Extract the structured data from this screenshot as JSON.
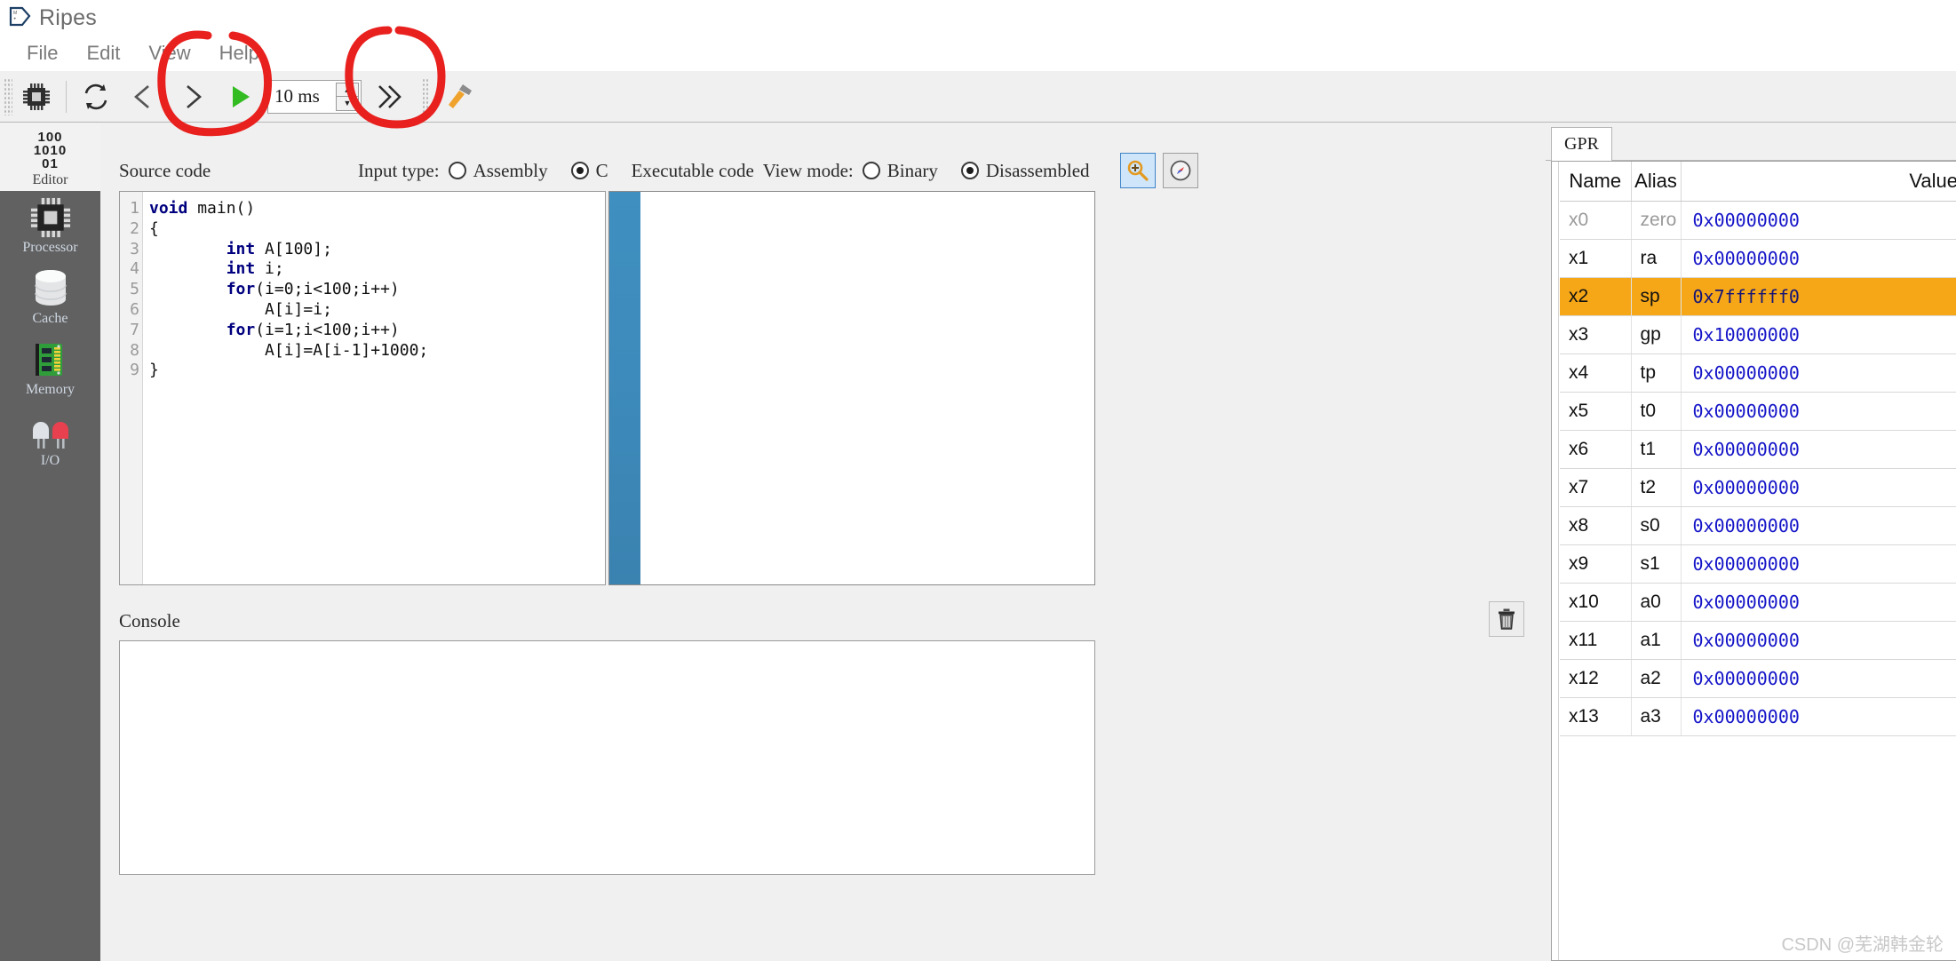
{
  "window": {
    "title": "Ripes",
    "logo_icon": "ripes-logo-icon"
  },
  "menubar": {
    "items": [
      {
        "label": "File"
      },
      {
        "label": "Edit"
      },
      {
        "label": "View"
      },
      {
        "label": "Help"
      }
    ]
  },
  "toolbar": {
    "buttons": [
      {
        "name": "processor-select-button",
        "icon": "cpu-chip-icon"
      },
      {
        "name": "reset-button",
        "icon": "reset-arrows-icon"
      },
      {
        "name": "reverse-button",
        "icon": "step-back-chevron-icon"
      },
      {
        "name": "step-button",
        "icon": "step-forward-chevron-icon"
      },
      {
        "name": "run-button",
        "icon": "play-triangle-icon"
      },
      {
        "name": "fast-forward-button",
        "icon": "double-chevron-right-icon"
      },
      {
        "name": "build-button",
        "icon": "hammer-icon"
      }
    ],
    "clock_interval": {
      "value": "10 ms",
      "spin_up": "▲",
      "spin_down": "▼"
    }
  },
  "sidebar": {
    "items": [
      {
        "label": "Editor",
        "icon": "binary-digits-icon",
        "active": true,
        "glyph": "100\n1010\n01"
      },
      {
        "label": "Processor",
        "icon": "cpu-chip-icon",
        "active": false
      },
      {
        "label": "Cache",
        "icon": "database-cylinder-icon",
        "active": false
      },
      {
        "label": "Memory",
        "icon": "ram-stick-icon",
        "active": false
      },
      {
        "label": "I/O",
        "icon": "led-lights-icon",
        "active": false
      }
    ]
  },
  "editor": {
    "source_label": "Source code",
    "input_type_label": "Input type:",
    "input_type_options": [
      {
        "label": "Assembly",
        "selected": false
      },
      {
        "label": "C",
        "selected": true
      }
    ],
    "executable_label": "Executable code",
    "view_mode_label": "View mode:",
    "view_mode_options": [
      {
        "label": "Binary",
        "selected": false
      },
      {
        "label": "Disassembled",
        "selected": true
      }
    ],
    "action_icons": [
      {
        "name": "inspect-magnifier-icon",
        "selected": true
      },
      {
        "name": "compass-icon",
        "selected": false
      }
    ],
    "code_lines": [
      {
        "n": "1",
        "text": "void main()"
      },
      {
        "n": "2",
        "text": "{"
      },
      {
        "n": "3",
        "text": "        int A[100];"
      },
      {
        "n": "4",
        "text": "        int i;"
      },
      {
        "n": "5",
        "text": "        for(i=0;i<100;i++)"
      },
      {
        "n": "6",
        "text": "            A[i]=i;"
      },
      {
        "n": "7",
        "text": "        for(i=1;i<100;i++)"
      },
      {
        "n": "8",
        "text": "            A[i]=A[i-1]+1000;"
      },
      {
        "n": "9",
        "text": "}"
      }
    ],
    "executable_content": ""
  },
  "console": {
    "label": "Console",
    "content": "",
    "clear_icon": "trash-can-icon"
  },
  "registers": {
    "tab": "GPR",
    "columns": [
      "Name",
      "Alias",
      "Value"
    ],
    "rows": [
      {
        "name": "x0",
        "alias": "zero",
        "value": "0x00000000",
        "dim": true
      },
      {
        "name": "x1",
        "alias": "ra",
        "value": "0x00000000"
      },
      {
        "name": "x2",
        "alias": "sp",
        "value": "0x7ffffff0",
        "highlight": true
      },
      {
        "name": "x3",
        "alias": "gp",
        "value": "0x10000000"
      },
      {
        "name": "x4",
        "alias": "tp",
        "value": "0x00000000"
      },
      {
        "name": "x5",
        "alias": "t0",
        "value": "0x00000000"
      },
      {
        "name": "x6",
        "alias": "t1",
        "value": "0x00000000"
      },
      {
        "name": "x7",
        "alias": "t2",
        "value": "0x00000000"
      },
      {
        "name": "x8",
        "alias": "s0",
        "value": "0x00000000"
      },
      {
        "name": "x9",
        "alias": "s1",
        "value": "0x00000000"
      },
      {
        "name": "x10",
        "alias": "a0",
        "value": "0x00000000"
      },
      {
        "name": "x11",
        "alias": "a1",
        "value": "0x00000000"
      },
      {
        "name": "x12",
        "alias": "a2",
        "value": "0x00000000"
      },
      {
        "name": "x13",
        "alias": "a3",
        "value": "0x00000000"
      }
    ]
  },
  "annotations": {
    "color": "#e8201e",
    "shapes": [
      "circle-around-run-button",
      "circle-around-build-button"
    ]
  },
  "watermark": {
    "text": "CSDN @芜湖韩金轮"
  }
}
